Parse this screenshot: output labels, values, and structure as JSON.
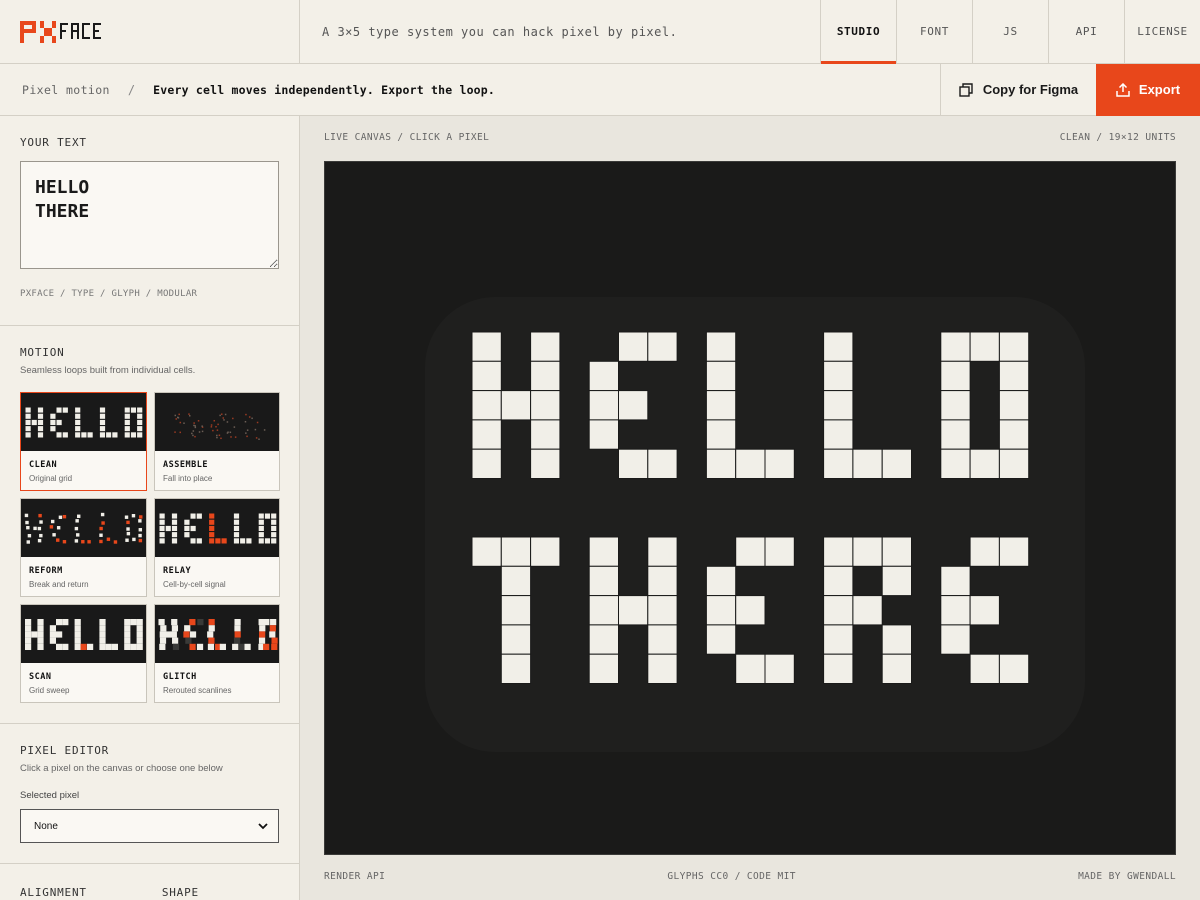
{
  "app": {
    "tagline": "A 3×5 type system you can hack pixel by pixel."
  },
  "nav": {
    "tabs": [
      {
        "label": "STUDIO",
        "active": true
      },
      {
        "label": "FONT",
        "active": false
      },
      {
        "label": "JS",
        "active": false
      },
      {
        "label": "API",
        "active": false
      },
      {
        "label": "LICENSE",
        "active": false
      }
    ]
  },
  "subbar": {
    "crumb": "Pixel motion",
    "separator": "/",
    "description": "Every cell moves independently. Export the loop.",
    "figma_label": "Copy for Figma",
    "export_label": "Export"
  },
  "sidebar": {
    "text_section": {
      "title": "YOUR TEXT",
      "value": "HELLO\nTHERE",
      "tags": "PXFACE / TYPE / GLYPH / MODULAR"
    },
    "motion": {
      "title": "MOTION",
      "subtitle": "Seamless loops built from individual cells.",
      "cards": [
        {
          "label": "CLEAN",
          "sub": "Original grid",
          "selected": true
        },
        {
          "label": "ASSEMBLE",
          "sub": "Fall into place",
          "selected": false
        },
        {
          "label": "REFORM",
          "sub": "Break and return",
          "selected": false
        },
        {
          "label": "RELAY",
          "sub": "Cell-by-cell signal",
          "selected": false
        },
        {
          "label": "SCAN",
          "sub": "Grid sweep",
          "selected": false
        },
        {
          "label": "GLITCH",
          "sub": "Rerouted scanlines",
          "selected": false
        }
      ]
    },
    "pixel_editor": {
      "title": "PIXEL EDITOR",
      "subtitle": "Click a pixel on the canvas or choose one below",
      "field_label": "Selected pixel",
      "selected_value": "None"
    },
    "alignment_title": "ALIGNMENT",
    "shape_title": "SHAPE"
  },
  "canvas": {
    "head_left": "LIVE CANVAS / CLICK A PIXEL",
    "head_right": "CLEAN / 19×12 UNITS",
    "foot_left": "RENDER API",
    "foot_center": "GLYPHS CC0 / CODE MIT",
    "foot_right": "MADE BY GWENDALL",
    "lines": [
      "HELLO",
      "THERE"
    ]
  },
  "colors": {
    "accent": "#e8471b",
    "ink": "#1a1a19",
    "cell": "#f1efe8",
    "paper": "#f3f0e8"
  },
  "icons": {
    "figma": "copy-icon",
    "export": "upload-icon",
    "select": "chevron-down-icon"
  }
}
